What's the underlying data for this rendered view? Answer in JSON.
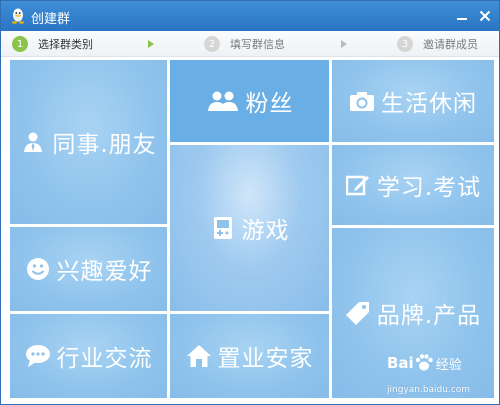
{
  "window": {
    "title": "创建群"
  },
  "steps": [
    {
      "num": "1",
      "label": "选择群类别",
      "state": "active"
    },
    {
      "num": "2",
      "label": "填写群信息",
      "state": "inactive"
    },
    {
      "num": "3",
      "label": "邀请群成员",
      "state": "inactive"
    }
  ],
  "tiles": {
    "colleagues": {
      "label": "同事.朋友",
      "icon": "person-icon"
    },
    "fans": {
      "label": "粉丝",
      "icon": "people-icon"
    },
    "life": {
      "label": "生活休闲",
      "icon": "camera-icon"
    },
    "games": {
      "label": "游戏",
      "icon": "gamepad-icon"
    },
    "study": {
      "label": "学习.考试",
      "icon": "edit-icon"
    },
    "interests": {
      "label": "兴趣爱好",
      "icon": "smiley-icon"
    },
    "brand": {
      "label": "品牌.产品",
      "icon": "tag-icon"
    },
    "industry": {
      "label": "行业交流",
      "icon": "chat-icon"
    },
    "home": {
      "label": "置业安家",
      "icon": "house-icon"
    }
  },
  "watermark": {
    "brand": "Bai",
    "brand2": "经验",
    "url": "jingyan.baidu.com"
  },
  "colors": {
    "titlebar": "#2a75c3",
    "tile": "#8fc3ec",
    "tile_dark": "#6aaee6",
    "step_active": "#8cc34a"
  }
}
